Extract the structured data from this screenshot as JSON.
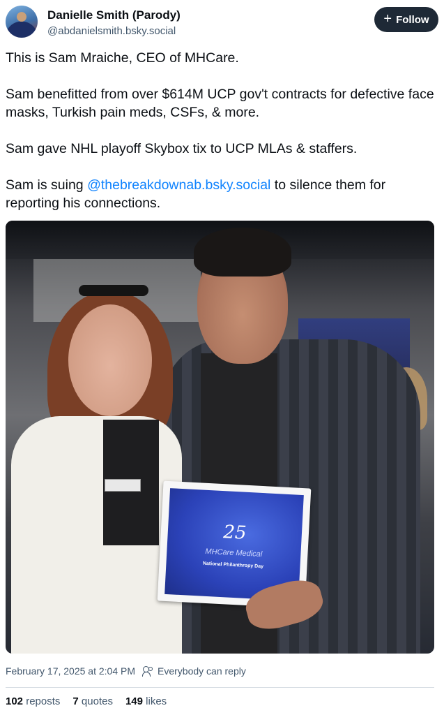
{
  "author": {
    "name": "Danielle Smith (Parody)",
    "handle": "@abdanielsmith.bsky.social"
  },
  "follow_button": {
    "icon": "plus-icon",
    "label": "Follow"
  },
  "post": {
    "paragraphs": [
      "This is Sam Mraiche, CEO of MHCare.",
      "Sam benefitted from over $614M UCP gov't contracts for defective face masks, Turkish pain meds, CSFs, & more.",
      "Sam gave NHL playoff Skybox tix to UCP MLAs & staffers."
    ],
    "last_paragraph": {
      "before": "Sam is suing ",
      "mention": "@thebreakdownab.bsky.social",
      "after": " to silence them for reporting his connections."
    },
    "photo": {
      "plaque_number": "25",
      "plaque_title": "MHCare Medical",
      "plaque_subtitle": "National Philanthropy Day"
    }
  },
  "meta": {
    "timestamp": "February 17, 2025 at 2:04 PM",
    "reply_icon": "people-icon",
    "reply_setting": "Everybody can reply"
  },
  "stats": {
    "reposts_count": "102",
    "reposts_label": "reposts",
    "quotes_count": "7",
    "quotes_label": "quotes",
    "likes_count": "149",
    "likes_label": "likes"
  },
  "colors": {
    "link": "#1083fe",
    "follow_bg": "#1e2936",
    "muted_text": "#42576c"
  }
}
